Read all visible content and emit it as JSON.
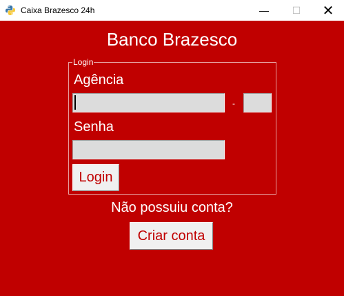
{
  "window": {
    "title": "Caixa Brazesco 24h",
    "minimize_glyph": "—",
    "maximize_glyph": "☐",
    "close_glyph": "✕",
    "icon": "python-icon"
  },
  "main": {
    "bank_title": "Banco Brazesco",
    "login_group": {
      "legend": "Login",
      "agency_label": "Agência",
      "agency_value": "",
      "separator": "-",
      "agency_digit_value": "",
      "password_label": "Senha",
      "password_value": "",
      "login_button": "Login"
    },
    "no_account_text": "Não possuiu conta?",
    "create_account_button": "Criar conta"
  },
  "colors": {
    "background": "#c00000",
    "field": "#dcdcdc",
    "button": "#f0f0f0",
    "button_text": "#c00000"
  }
}
